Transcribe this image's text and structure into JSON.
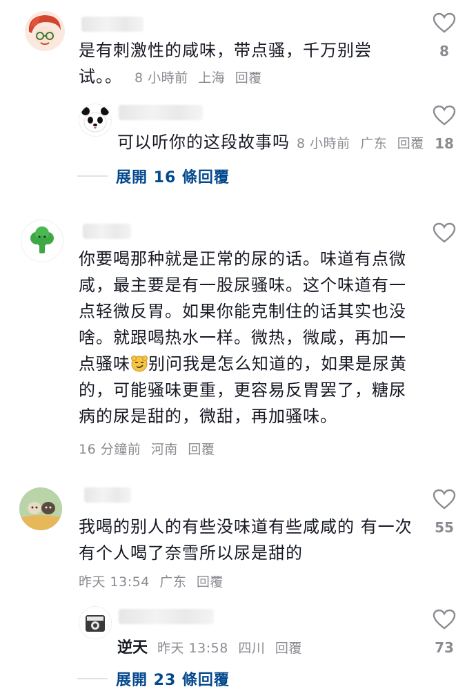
{
  "comments": [
    {
      "text": "是有刺激性的咸味，带点骚，千万别尝试。。",
      "time": "8 小時前",
      "region": "上海",
      "reply": "回覆",
      "likes": "8"
    },
    {
      "text": "可以听你的这段故事吗",
      "time": "8 小時前",
      "region": "广东",
      "reply": "回覆",
      "likes": "18"
    },
    {
      "expand": "展開 16 條回覆"
    },
    {
      "text_before_emoji": "你要喝那种就是正常的尿的话。味道有点微咸，最主要是有一股尿骚味。这个味道有一点轻微反胃。如果你能克制住的话其实也没啥。就跟喝热水一样。微热，微咸，再加一点骚味",
      "text_after_emoji": "别问我是怎么知道的，如果是尿黄的，可能骚味更重，更容易反胃罢了，糖尿病的尿是甜的，微甜，再加骚味。",
      "time": "16 分鐘前",
      "region": "河南",
      "reply": "回覆"
    },
    {
      "text": "我喝的别人的有些没味道有些咸咸的 有一次有个人喝了奈雪所以尿是甜的",
      "time": "昨天 13:54",
      "region": "广东",
      "reply": "回覆",
      "likes": "55"
    },
    {
      "username": "逆天",
      "time": "昨天 13:58",
      "region": "四川",
      "reply": "回覆",
      "likes": "73"
    },
    {
      "expand": "展開 23 條回覆"
    }
  ],
  "lines": {
    "c0l1": "是有刺激性的咸味，带点骚，千万别尝",
    "c0l2": "试。。",
    "c3l1": "你要喝那种就是正常的尿的话。味道有点微",
    "c3l2": "咸，最主要是有一股尿骚味。这个味道有一",
    "c3l3": "点轻微反胃。如果你能克制住的话其实也没",
    "c3l4": "啥。就跟喝热水一样。微热，微咸，再加一",
    "c3l5a": "点骚味",
    "c3l5b": "别问我是怎么知道的，如果是尿黄",
    "c3l6": "的，可能骚味更重，更容易反胃罢了，糖尿",
    "c3l7": "病的尿是甜的，微甜，再加骚味。",
    "c4l1": "我喝的别人的有些没味道有些咸咸的 有一次",
    "c4l2": "有个人喝了奈雪所以尿是甜的"
  },
  "colors": {
    "text": "#161823",
    "meta": "#8a8b91",
    "expand": "#04498d"
  }
}
